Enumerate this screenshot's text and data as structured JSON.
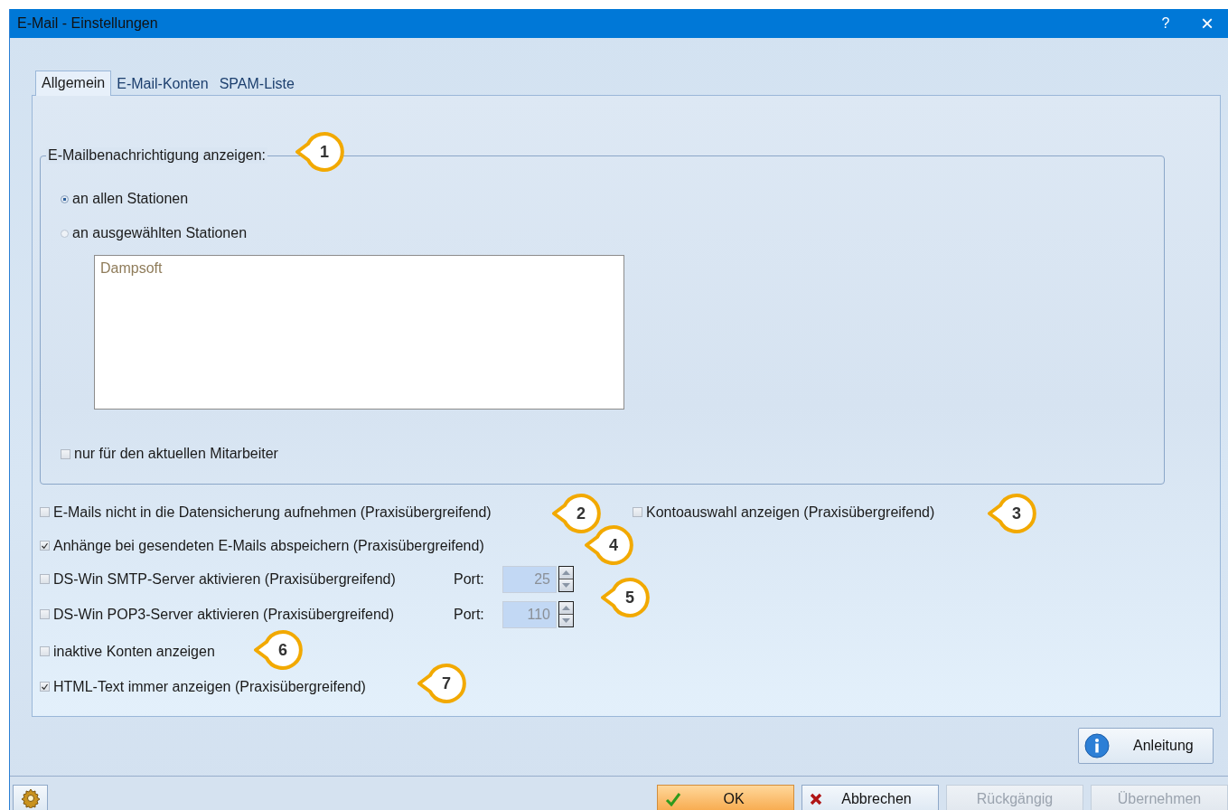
{
  "window": {
    "title": "E-Mail - Einstellungen",
    "controls": [
      {
        "kind": "help",
        "label": "?"
      },
      {
        "kind": "close",
        "label": "×"
      }
    ]
  },
  "tabs": [
    {
      "label": "Allgemein",
      "selected": true
    },
    {
      "label": "E-Mail-Konten",
      "selected": false
    },
    {
      "label": "SPAM-Liste",
      "selected": false
    }
  ],
  "notification_group": {
    "title": "E-Mailbenachrichtigung anzeigen:",
    "options": [
      {
        "label": "an allen Stationen",
        "selected": true
      },
      {
        "label": "an ausgewählten Stationen",
        "selected": false
      }
    ],
    "stations": [
      "Dampsoft"
    ],
    "current_employee_only": {
      "label": "nur für den aktuellen Mitarbeiter",
      "checked": false
    }
  },
  "rows": [
    {
      "items": [
        {
          "kind": "checkbox",
          "label": "E-Mails nicht in die Datensicherung aufnehmen (Praxisübergreifend)",
          "checked": false
        },
        {
          "kind": "checkbox",
          "label": "Kontoauswahl anzeigen (Praxisübergreifend)",
          "checked": false
        }
      ]
    },
    {
      "items": [
        {
          "kind": "checkbox",
          "label": "Anhänge bei gesendeten E-Mails abspeichern (Praxisübergreifend)",
          "checked": true
        }
      ]
    },
    {
      "items": [
        {
          "kind": "checkbox",
          "label": "DS-Win SMTP-Server aktivieren (Praxisübergreifend)",
          "checked": false
        },
        {
          "kind": "port",
          "label": "Port:",
          "value": "25",
          "disabled": true
        }
      ]
    },
    {
      "items": [
        {
          "kind": "checkbox",
          "label": "DS-Win POP3-Server aktivieren (Praxisübergreifend)",
          "checked": false
        },
        {
          "kind": "port",
          "label": "Port:",
          "value": "110",
          "disabled": true
        }
      ]
    },
    {
      "items": [
        {
          "kind": "checkbox",
          "label": "inaktive Konten anzeigen",
          "checked": false
        }
      ]
    },
    {
      "items": [
        {
          "kind": "checkbox",
          "label": "HTML-Text immer anzeigen (Praxisübergreifend)",
          "checked": true
        }
      ]
    }
  ],
  "callouts": [
    {
      "number": "1"
    },
    {
      "number": "2"
    },
    {
      "number": "3"
    },
    {
      "number": "4"
    },
    {
      "number": "5"
    },
    {
      "number": "6"
    },
    {
      "number": "7"
    }
  ],
  "help_button": {
    "label": "Anleitung"
  },
  "buttons": [
    {
      "kind": "ok",
      "label": "OK",
      "disabled": false
    },
    {
      "kind": "cancel",
      "label": "Abbrechen",
      "disabled": false
    },
    {
      "kind": "plain",
      "label": "Rückgängig",
      "disabled": true
    },
    {
      "kind": "plain",
      "label": "Übernehmen",
      "disabled": true
    }
  ]
}
